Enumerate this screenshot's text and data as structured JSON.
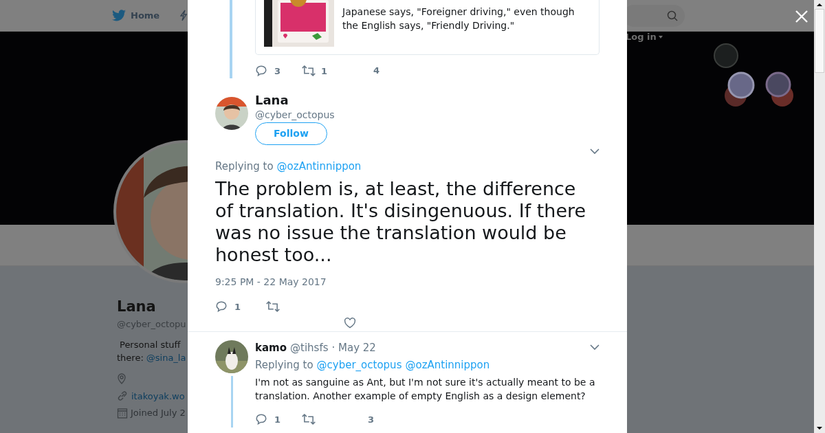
{
  "nav": {
    "home": "Home",
    "login": "Log in"
  },
  "profile": {
    "name": "Lana",
    "handle": "@cyber_octopu",
    "bio": "Personal stuff",
    "bio_prefix": "there:",
    "bio_link": "@sina_la",
    "website": "itakoyak.wo",
    "joined": "Joined July 2"
  },
  "parent_tweet": {
    "text": "Japanese says, \"Foreigner driving,\" even though the English says, \"Friendly Driving.\"",
    "replies": "3",
    "retweets": "1",
    "likes": "4"
  },
  "main_tweet": {
    "name": "Lana",
    "handle": "@cyber_octopus",
    "follow": "Follow",
    "replying_label": "Replying to",
    "replying_to": [
      "@ozAntinnippon"
    ],
    "text": "The problem is, at least, the difference of translation. It's disingenuous. If there was no issue the translation would be honest too...",
    "time": "9:25 PM - 22 May 2017",
    "replies": "1"
  },
  "replies": [
    {
      "name": "kamo",
      "handle": "@tihsfs",
      "date": "· May 22",
      "replying_label": "Replying to",
      "replying_to": [
        "@cyber_octopus",
        "@ozAntinnippon"
      ],
      "text": "I'm not as sanguine as Ant, but I'm not sure it's actually meant to be a translation. Another example of empty English as a design element?",
      "replies": "1",
      "likes": "3"
    }
  ]
}
